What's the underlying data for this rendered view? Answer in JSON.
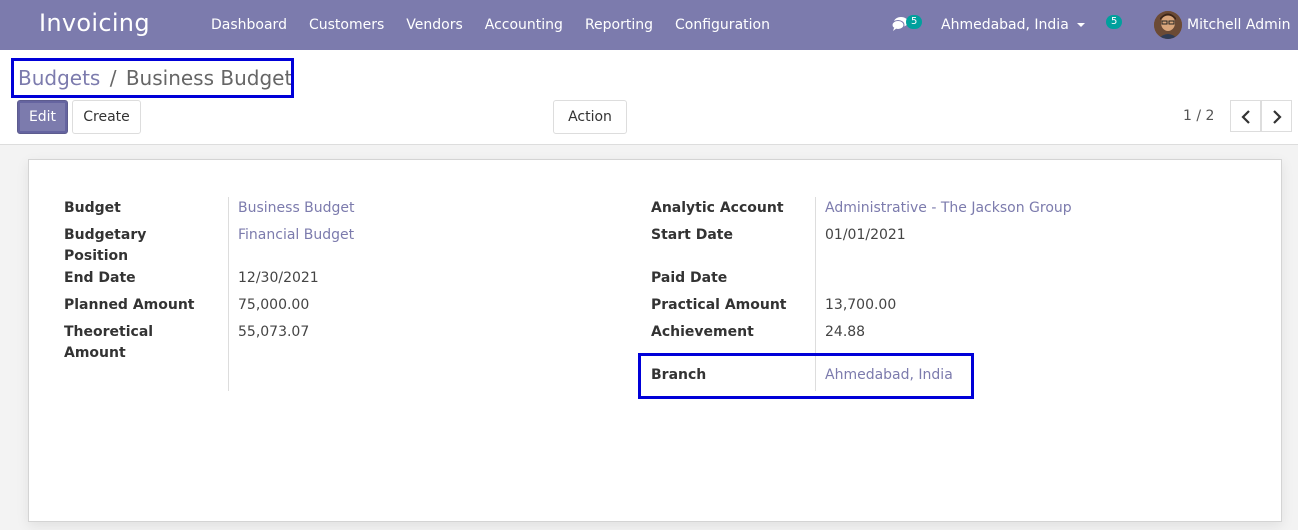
{
  "navbar": {
    "brand": "Invoicing",
    "menu": [
      "Dashboard",
      "Customers",
      "Vendors",
      "Accounting",
      "Reporting",
      "Configuration"
    ],
    "chat_count": "5",
    "company": "Ahmedabad, India",
    "activity_count": "5",
    "user": "Mitchell Admin"
  },
  "breadcrumb": {
    "parent": "Budgets",
    "separator": "/",
    "current": "Business Budget"
  },
  "buttons": {
    "edit": "Edit",
    "create": "Create",
    "action": "Action"
  },
  "pager": {
    "value": "1 / 2"
  },
  "form": {
    "left": {
      "budget_label": "Budget",
      "budget_value": "Business Budget",
      "position_label_1": "Budgetary",
      "position_label_2": "Position",
      "position_value": "Financial Budget",
      "end_date_label": "End Date",
      "end_date_value": "12/30/2021",
      "planned_label": "Planned Amount",
      "planned_value": "75,000.00",
      "theoretical_label_1": "Theoretical",
      "theoretical_label_2": "Amount",
      "theoretical_value": "55,073.07"
    },
    "right": {
      "analytic_label": "Analytic Account",
      "analytic_value": "Administrative - The Jackson Group",
      "start_date_label": "Start Date",
      "start_date_value": "01/01/2021",
      "paid_date_label": "Paid Date",
      "paid_date_value": "",
      "practical_label": "Practical Amount",
      "practical_value": "13,700.00",
      "achievement_label": "Achievement",
      "achievement_value": "24.88",
      "branch_label": "Branch",
      "branch_value": "Ahmedabad, India"
    }
  },
  "colors": {
    "navbar": "#7c7bad",
    "link": "#7c7bad",
    "badge": "#00a09d",
    "highlight": "#0000d8"
  },
  "icons": [
    "chat-icon",
    "caret-down-icon",
    "chevron-left-icon",
    "chevron-right-icon"
  ]
}
